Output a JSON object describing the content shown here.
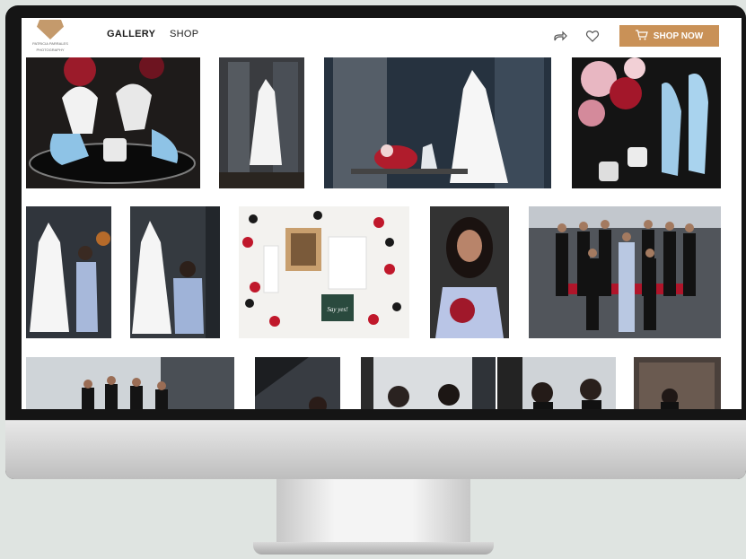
{
  "nav": {
    "logo_line1": "PATRICIA PARRALES",
    "logo_line2": "PHOTOGRAPHY",
    "gallery": "GALLERY",
    "shop": "SHOP",
    "shop_now": "SHOP NOW",
    "share_icon": "share-icon",
    "heart_icon": "heart-icon",
    "cart_icon": "cart-icon"
  },
  "accent_color": "#c99157",
  "photo_card_text": "Say yes!"
}
